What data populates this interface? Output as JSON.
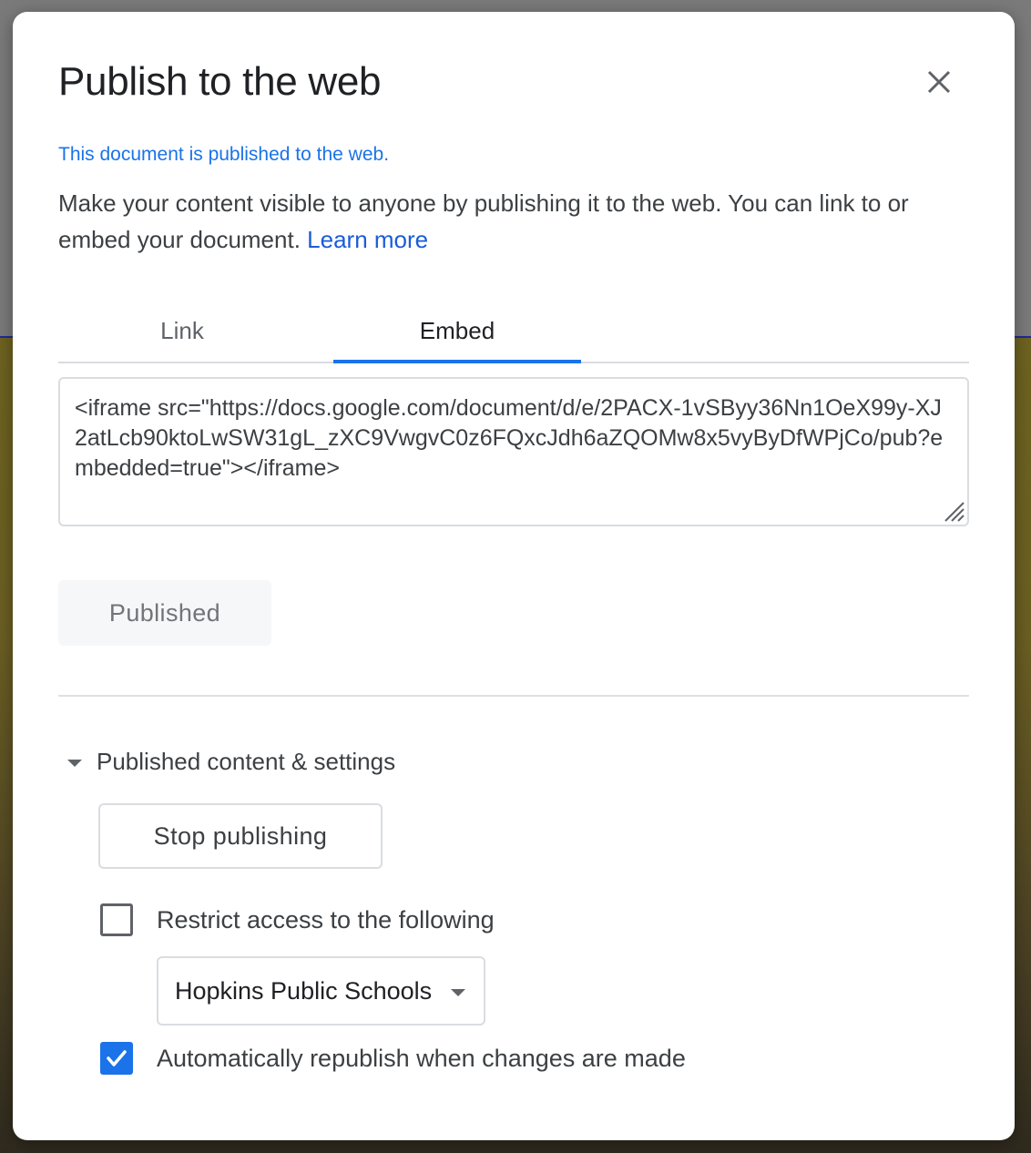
{
  "dialog": {
    "title": "Publish to the web",
    "status": "This document is published to the web.",
    "description": "Make your content visible to anyone by publishing it to the web. You can link to or embed your document. ",
    "learn_more": "Learn more"
  },
  "tabs": [
    {
      "label": "Link",
      "active": false
    },
    {
      "label": "Embed",
      "active": true
    }
  ],
  "embed_code": "<iframe src=\"https://docs.google.com/document/d/e/2PACX-1vSByy36Nn1OeX99y-XJ2atLcb90ktoLwSW31gL_zXC9VwgvC0z6FQxcJdh6aZQOMw8x5vyByDfWPjCo/pub?embedded=true\"></iframe>",
  "buttons": {
    "published": "Published",
    "stop_publishing": "Stop publishing"
  },
  "settings": {
    "section_label": "Published content & settings",
    "restrict_label": "Restrict access to the following",
    "restrict_checked": false,
    "domain_selected": "Hopkins Public Schools",
    "auto_republish_label": "Automatically republish when changes are made",
    "auto_republish_checked": true
  },
  "colors": {
    "accent": "#1a73e8",
    "link": "#1a5cd8"
  },
  "icons": {
    "close": "close-icon",
    "checkmark": "checkmark-icon",
    "caret": "caret-down-icon"
  }
}
